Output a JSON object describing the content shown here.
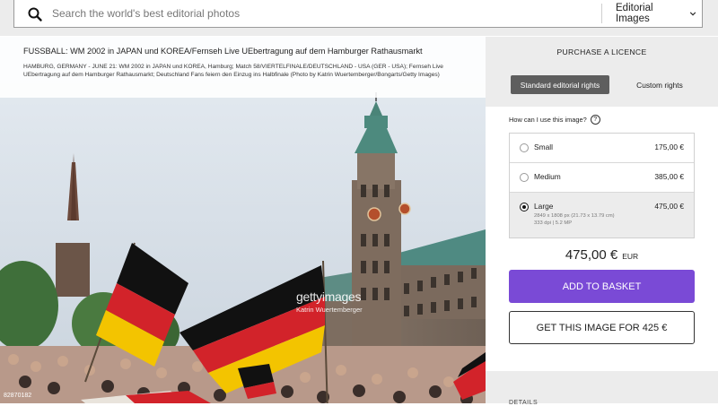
{
  "search": {
    "placeholder": "Search the world's best editorial photos",
    "filter_selected": "Editorial Images"
  },
  "image": {
    "title": "FUSSBALL: WM 2002 in JAPAN und KOREA/Fernseh Live UEbertragung auf dem Hamburger Rathausmarkt",
    "description": "HAMBURG, GERMANY - JUNE 21: WM 2002 in JAPAN und KOREA, Hamburg; Match 58/VIERTELFINALE/DEUTSCHLAND - USA (GER - USA); Fernseh Live UEbertragung auf dem Hamburger Rathausmarkt; Deutschland Fans feiern den Einzug ins Halbfinale (Photo by Katrin Wuertemberger/Bongarts/Getty Images)",
    "watermark_logo": "gettyimages",
    "watermark_credit": "Katrin Wuertemberger",
    "image_id": "82870182"
  },
  "purchase": {
    "heading": "PURCHASE A LICENCE",
    "tabs": [
      "Standard editorial rights",
      "Custom rights"
    ],
    "usage_question": "How can I use this image?",
    "help_symbol": "?",
    "options": [
      {
        "name": "Small",
        "price": "175,00 €",
        "selected": false
      },
      {
        "name": "Medium",
        "price": "385,00 €",
        "selected": false
      },
      {
        "name": "Large",
        "price": "475,00 €",
        "selected": true,
        "dims": "2849 x 1808 px (21.73 x 13.79 cm)",
        "dpi": "333 dpi | 5.2 MP"
      }
    ],
    "total_amount": "475,00 €",
    "total_currency": "EUR",
    "add_to_basket": "ADD TO BASKET",
    "offer_button": "GET THIS IMAGE FOR 425 €",
    "details_heading": "DETAILS"
  },
  "colors": {
    "accent": "#7a4ad6",
    "panel_bg": "#ececec"
  }
}
